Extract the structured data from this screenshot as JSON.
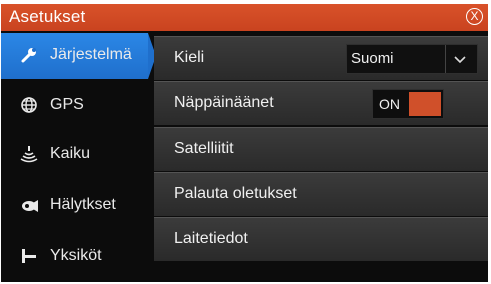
{
  "window": {
    "title": "Asetukset",
    "close_label": "X"
  },
  "sidebar": {
    "items": [
      {
        "label": "Järjestelmä",
        "icon": "wrench-icon",
        "active": true
      },
      {
        "label": "GPS",
        "icon": "globe-icon",
        "active": false
      },
      {
        "label": "Kaiku",
        "icon": "sonar-icon",
        "active": false
      },
      {
        "label": "Hälytkset",
        "icon": "alarm-horn-icon",
        "active": false
      },
      {
        "label": "Yksiköt",
        "icon": "units-icon",
        "active": false
      }
    ]
  },
  "content": {
    "language": {
      "label": "Kieli",
      "value": "Suomi"
    },
    "key_beeps": {
      "label": "Näppäinäänet",
      "state": "ON"
    },
    "satellites": {
      "label": "Satelliitit"
    },
    "restore_defaults": {
      "label": "Palauta oletukset"
    },
    "device_info": {
      "label": "Laitetiedot"
    }
  },
  "colors": {
    "title_bar": "#d0502a",
    "active_tab": "#2b87e6",
    "toggle_on": "#d0502a",
    "background": "#0c0c0c"
  }
}
